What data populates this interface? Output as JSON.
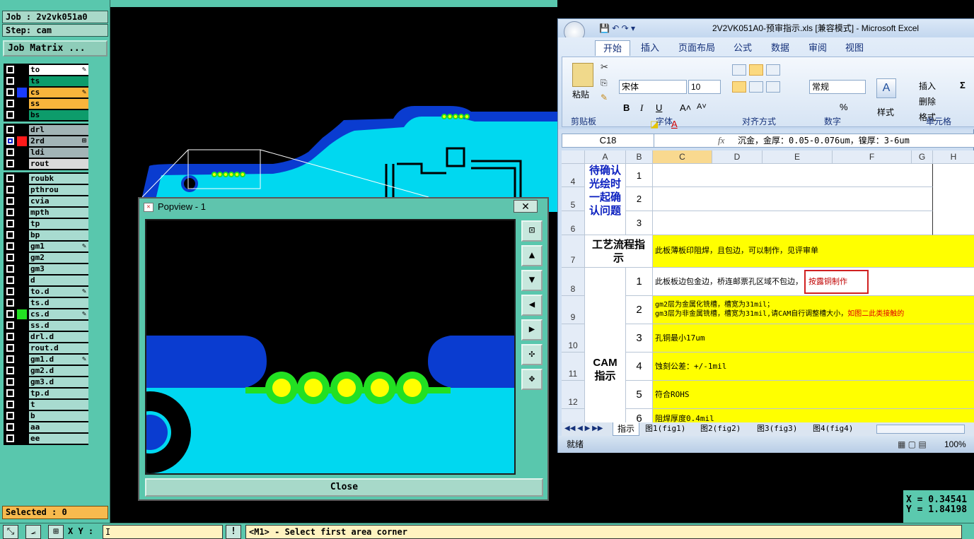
{
  "left_panel": {
    "job": "Job : 2v2vk051a0",
    "step": "Step: cam",
    "job_matrix": "Job Matrix ...",
    "selected": "Selected : 0",
    "layers": [
      {
        "name": "to",
        "sw": "#000000",
        "bg": "#ffffff",
        "mark": "✎",
        "cb": false
      },
      {
        "name": "ts",
        "sw": "#000000",
        "bg": "#0d9c6b",
        "mark": "",
        "cb": false
      },
      {
        "name": "cs",
        "sw": "#1a3cff",
        "bg": "#f9b53c",
        "mark": "✎",
        "cb": false
      },
      {
        "name": "ss",
        "sw": "#000000",
        "bg": "#f9b53c",
        "mark": "",
        "cb": false
      },
      {
        "name": "bs",
        "sw": "#000000",
        "bg": "#0d9c6b",
        "mark": "",
        "cb": false
      },
      {
        "name": "drl",
        "sw": "#000000",
        "bg": "#a2b4b6",
        "mark": "",
        "cb": false
      },
      {
        "name": "2rd",
        "sw": "#ff1a1a",
        "bg": "#a2b4b6",
        "mark": "⊞",
        "cb": true,
        "cbsw": "#0a1fcc"
      },
      {
        "name": "ldi",
        "sw": "#000000",
        "bg": "#a2b4b6",
        "mark": "",
        "cb": false
      },
      {
        "name": "rout",
        "sw": "#000000",
        "bg": "#d9d9d9",
        "mark": "",
        "cb": false
      },
      {
        "name": "roubk",
        "sw": "#000000",
        "bg": "#a8dbd0",
        "mark": "",
        "cb": false
      },
      {
        "name": "pthrou",
        "sw": "#000000",
        "bg": "#a8dbd0",
        "mark": "",
        "cb": false
      },
      {
        "name": "cvia",
        "sw": "#000000",
        "bg": "#a8dbd0",
        "mark": "",
        "cb": false
      },
      {
        "name": "mpth",
        "sw": "#000000",
        "bg": "#a8dbd0",
        "mark": "",
        "cb": false
      },
      {
        "name": "tp",
        "sw": "#000000",
        "bg": "#a8dbd0",
        "mark": "",
        "cb": false
      },
      {
        "name": "bp",
        "sw": "#000000",
        "bg": "#a8dbd0",
        "mark": "",
        "cb": false
      },
      {
        "name": "gm1",
        "sw": "#000000",
        "bg": "#a8dbd0",
        "mark": "✎",
        "cb": false
      },
      {
        "name": "gm2",
        "sw": "#000000",
        "bg": "#a8dbd0",
        "mark": "",
        "cb": false
      },
      {
        "name": "gm3",
        "sw": "#000000",
        "bg": "#a8dbd0",
        "mark": "",
        "cb": false
      },
      {
        "name": "d",
        "sw": "#000000",
        "bg": "#a8dbd0",
        "mark": "",
        "cb": false
      },
      {
        "name": "to.d",
        "sw": "#000000",
        "bg": "#a8dbd0",
        "mark": "✎",
        "cb": false
      },
      {
        "name": "ts.d",
        "sw": "#000000",
        "bg": "#a8dbd0",
        "mark": "",
        "cb": false
      },
      {
        "name": "cs.d",
        "sw": "#22e022",
        "bg": "#a8dbd0",
        "mark": "✎",
        "cb": false
      },
      {
        "name": "ss.d",
        "sw": "#000000",
        "bg": "#a8dbd0",
        "mark": "",
        "cb": false
      },
      {
        "name": "drl.d",
        "sw": "#000000",
        "bg": "#a8dbd0",
        "mark": "",
        "cb": false
      },
      {
        "name": "rout.d",
        "sw": "#000000",
        "bg": "#a8dbd0",
        "mark": "",
        "cb": false
      },
      {
        "name": "gm1.d",
        "sw": "#000000",
        "bg": "#a8dbd0",
        "mark": "✎",
        "cb": false
      },
      {
        "name": "gm2.d",
        "sw": "#000000",
        "bg": "#a8dbd0",
        "mark": "",
        "cb": false
      },
      {
        "name": "gm3.d",
        "sw": "#000000",
        "bg": "#a8dbd0",
        "mark": "",
        "cb": false
      },
      {
        "name": "tp.d",
        "sw": "#000000",
        "bg": "#a8dbd0",
        "mark": "",
        "cb": false
      },
      {
        "name": "t",
        "sw": "#000000",
        "bg": "#a8dbd0",
        "mark": "",
        "cb": false
      },
      {
        "name": "b",
        "sw": "#000000",
        "bg": "#a8dbd0",
        "mark": "",
        "cb": false
      },
      {
        "name": "aa",
        "sw": "#000000",
        "bg": "#a8dbd0",
        "mark": "",
        "cb": false
      },
      {
        "name": "ee",
        "sw": "#000000",
        "bg": "#a8dbd0",
        "mark": "",
        "cb": false
      }
    ]
  },
  "bottom_bar": {
    "xy_label": "X Y :",
    "xy_value": "I",
    "message": "<M1> - Select first area corner",
    "warn_icon": "!"
  },
  "coords": {
    "x": "X = 0.34541",
    "y": "Y = 1.84198"
  },
  "popview": {
    "title": "Popview - 1",
    "close_x": "✕",
    "close_label": "Close"
  },
  "excel": {
    "title": "2V2VK051A0-预审指示.xls [兼容模式] - Microsoft Excel",
    "tabs": [
      "开始",
      "插入",
      "页面布局",
      "公式",
      "数据",
      "审阅",
      "视图"
    ],
    "groups": [
      "剪贴板",
      "字体",
      "对齐方式",
      "数字",
      "样式",
      "单元格"
    ],
    "paste": "粘贴",
    "font": "宋体",
    "size": "10",
    "numfmt": "常规",
    "insert": "插入",
    "delete": "删除",
    "format": "格式",
    "style": "样式",
    "namebox": "C18",
    "fx": "fx",
    "formula": "沉金，金厚：0.05-0.076um，镍厚：3-6um",
    "cols": [
      "A",
      "B",
      "C",
      "D",
      "E",
      "F",
      "G",
      "H"
    ],
    "rows": [
      "4",
      "5",
      "6",
      "7",
      "8",
      "9",
      "10",
      "11",
      "12"
    ],
    "confirm_label": "待确认光绘时一起确认问题",
    "b_vals": [
      "1",
      "2",
      "3"
    ],
    "proc_label": "工艺流程指示",
    "proc_text": "此板薄板印阻焊，且包边，可以制作，见评审单",
    "cam_label": "CAM指示",
    "cam_nums": [
      "1",
      "2",
      "3",
      "4",
      "5",
      "6"
    ],
    "cam_r1a": "此板板边包金边，桥连邮票孔区域不包边，",
    "cam_r1b": "按露铜制作",
    "cam_r2a": "gm2层为金属化铣槽，槽宽为31mil；",
    "cam_r2b": "gm3层为非金属铣槽，槽宽为31mil,请CAM自行调整槽大小，",
    "cam_r2c": "如图二此类接触的",
    "cam_r3": "孔铜最小17um",
    "cam_r4": "蚀刻公差：+/-1mil",
    "cam_r5": "符合ROHS",
    "cam_r6": "阻焊厚度0.4mil",
    "sheets": [
      "指示",
      "图1(fig1)",
      "图2(fig2)",
      "图3(fig3)",
      "图4(fig4)"
    ],
    "status": "就绪",
    "zoom": "100%"
  },
  "colors": {
    "board": "#00d8f0",
    "copper": "#0a3cd0",
    "pad_green": "#22e022",
    "pad_yellow": "#ffff00",
    "panel": "#59c7ad"
  }
}
